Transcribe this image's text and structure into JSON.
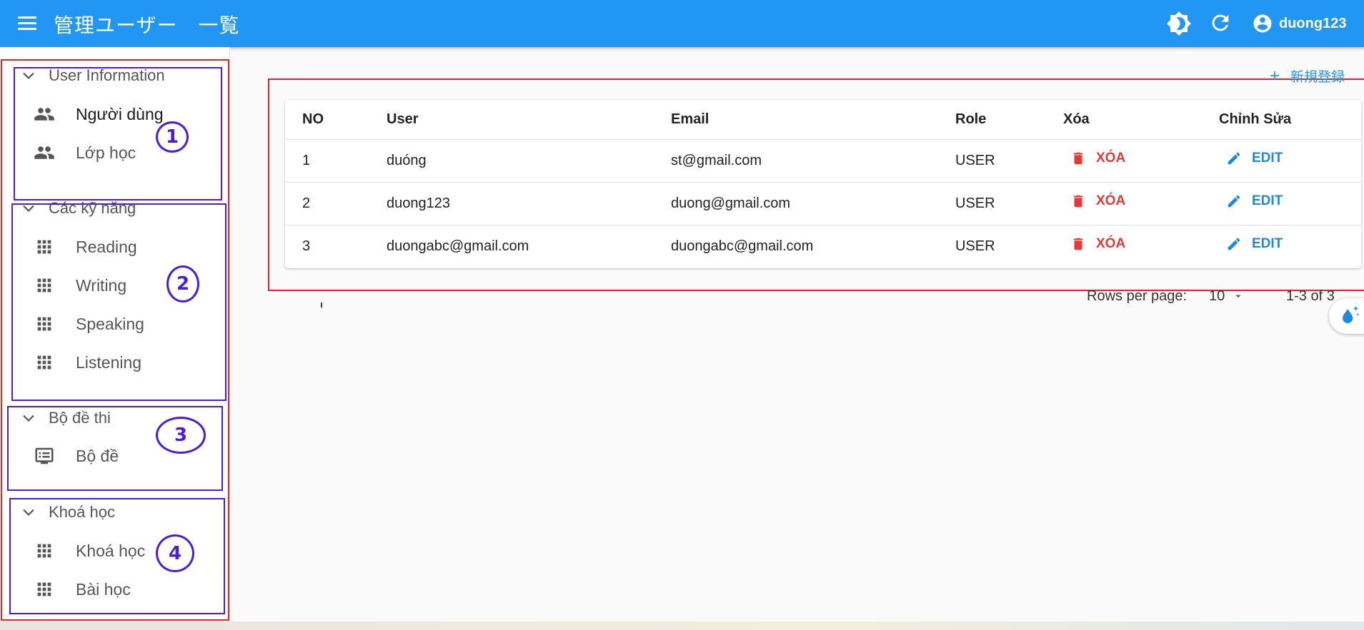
{
  "header": {
    "title": "管理ユーザー　一覧",
    "username": "duong123",
    "icons": [
      "menu-icon",
      "theme-toggle-icon",
      "refresh-icon",
      "account-circle-icon"
    ]
  },
  "sidebar": {
    "groups": [
      {
        "label": "User Information",
        "items": [
          {
            "label": "Người dùng",
            "icon": "people-icon"
          },
          {
            "label": "Lớp học",
            "icon": "people-icon"
          }
        ]
      },
      {
        "label": "Các kỹ năng",
        "items": [
          {
            "label": "Reading",
            "icon": "grid-icon"
          },
          {
            "label": "Writing",
            "icon": "grid-icon"
          },
          {
            "label": "Speaking",
            "icon": "grid-icon"
          },
          {
            "label": "Listening",
            "icon": "grid-icon"
          }
        ]
      },
      {
        "label": "Bộ đề thi",
        "items": [
          {
            "label": "Bộ đề",
            "icon": "list-icon"
          }
        ]
      },
      {
        "label": "Khoá học",
        "items": [
          {
            "label": "Khoá học",
            "icon": "grid-icon"
          },
          {
            "label": "Bài học",
            "icon": "grid-icon"
          }
        ]
      }
    ]
  },
  "annotations": [
    "1",
    "2",
    "3",
    "4"
  ],
  "main": {
    "add_label": "新規登録",
    "table": {
      "headers": [
        "NO",
        "User",
        "Email",
        "Role",
        "Xóa",
        "Chỉnh Sửa"
      ],
      "rows": [
        {
          "no": "1",
          "user": "duóng",
          "email": "st@gmail.com",
          "role": "USER",
          "delete": "XÓA",
          "edit": "EDIT"
        },
        {
          "no": "2",
          "user": "duong123",
          "email": "duong@gmail.com",
          "role": "USER",
          "delete": "XÓA",
          "edit": "EDIT"
        },
        {
          "no": "3",
          "user": "duongabc@gmail.com",
          "email": "duongabc@gmail.com",
          "role": "USER",
          "delete": "XÓA",
          "edit": "EDIT"
        }
      ]
    },
    "pagination": {
      "rows_per_page_label": "Rows per page:",
      "rows_per_page": "10",
      "range": "1-3 of 3"
    }
  },
  "colors": {
    "appbar": "#2196f3",
    "delete": "#e53935",
    "edit": "#1e88e5",
    "annotation_red": "#ee2222",
    "annotation_blue": "#4a1de0"
  }
}
